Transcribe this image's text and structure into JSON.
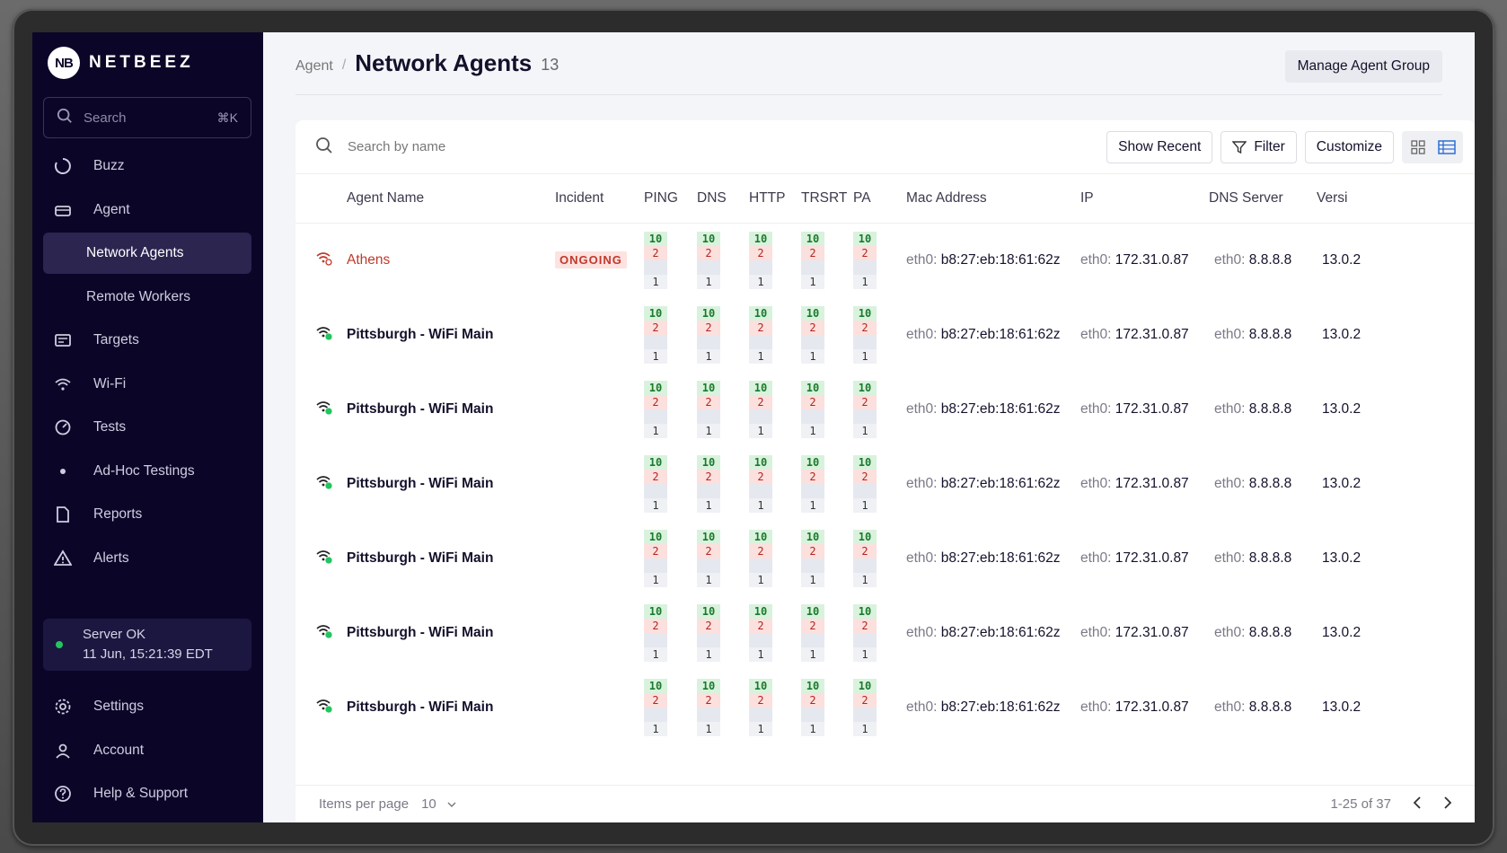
{
  "brand": {
    "logo_mark": "NB",
    "name": "NETBEEZ"
  },
  "sidebar": {
    "search_label": "Search",
    "search_shortcut": "⌘K",
    "items": [
      {
        "label": "Buzz",
        "icon": "buzz-icon"
      },
      {
        "label": "Agent",
        "icon": "agent-icon"
      },
      {
        "label": "Network Agents",
        "active": true
      },
      {
        "label": "Remote Workers"
      },
      {
        "label": "Targets",
        "icon": "targets-icon"
      },
      {
        "label": "Wi-Fi",
        "icon": "wifi-icon"
      },
      {
        "label": "Tests",
        "icon": "tests-icon"
      },
      {
        "label": "Ad-Hoc Testings",
        "icon": "dot-icon"
      },
      {
        "label": "Reports",
        "icon": "reports-icon"
      },
      {
        "label": "Alerts",
        "icon": "alerts-icon"
      }
    ],
    "server_status": {
      "label": "Server OK",
      "time": "11 Jun, 15:21:39 EDT",
      "color": "#22c55e"
    },
    "bottom_items": [
      {
        "label": "Settings",
        "icon": "gear-icon"
      },
      {
        "label": "Account",
        "icon": "account-icon"
      },
      {
        "label": "Help & Support",
        "icon": "help-icon"
      }
    ]
  },
  "header": {
    "breadcrumb": "Agent",
    "separator": "/",
    "title": "Network Agents",
    "count": "13",
    "manage_button": "Manage Agent Group"
  },
  "toolbar": {
    "search_placeholder": "Search by name",
    "show_recent": "Show Recent",
    "filter": "Filter",
    "customize": "Customize"
  },
  "table": {
    "columns": [
      "Agent Name",
      "Incident",
      "PING",
      "DNS",
      "HTTP",
      "TRSRT",
      "PA",
      "Mac Address",
      "IP",
      "DNS Server",
      "Versi"
    ],
    "metric": {
      "top": "10",
      "mid": "2",
      "bottom": "1"
    },
    "iface": "eth0:",
    "rows": [
      {
        "name": "Athens",
        "status": "error",
        "incident": "ONGOING",
        "mac": "b8:27:eb:18:61:62z",
        "ip": "172.31.0.87",
        "dns": "8.8.8.8",
        "version": "13.0.2"
      },
      {
        "name": "Pittsburgh - WiFi Main",
        "status": "ok",
        "incident": "",
        "mac": "b8:27:eb:18:61:62z",
        "ip": "172.31.0.87",
        "dns": "8.8.8.8",
        "version": "13.0.2"
      },
      {
        "name": "Pittsburgh - WiFi Main",
        "status": "ok",
        "incident": "",
        "mac": "b8:27:eb:18:61:62z",
        "ip": "172.31.0.87",
        "dns": "8.8.8.8",
        "version": "13.0.2"
      },
      {
        "name": "Pittsburgh - WiFi Main",
        "status": "ok",
        "incident": "",
        "mac": "b8:27:eb:18:61:62z",
        "ip": "172.31.0.87",
        "dns": "8.8.8.8",
        "version": "13.0.2"
      },
      {
        "name": "Pittsburgh - WiFi Main",
        "status": "ok",
        "incident": "",
        "mac": "b8:27:eb:18:61:62z",
        "ip": "172.31.0.87",
        "dns": "8.8.8.8",
        "version": "13.0.2"
      },
      {
        "name": "Pittsburgh - WiFi Main",
        "status": "ok",
        "incident": "",
        "mac": "b8:27:eb:18:61:62z",
        "ip": "172.31.0.87",
        "dns": "8.8.8.8",
        "version": "13.0.2"
      },
      {
        "name": "Pittsburgh - WiFi Main",
        "status": "ok",
        "incident": "",
        "mac": "b8:27:eb:18:61:62z",
        "ip": "172.31.0.87",
        "dns": "8.8.8.8",
        "version": "13.0.2"
      }
    ]
  },
  "footer": {
    "items_per_page_label": "Items per page",
    "items_per_page_value": "10",
    "range": "1-25 of 37"
  },
  "colors": {
    "sidebar_bg": "#0b0628",
    "active_bg": "#2b2550",
    "ok": "#22c55e",
    "error": "#c0392b"
  }
}
